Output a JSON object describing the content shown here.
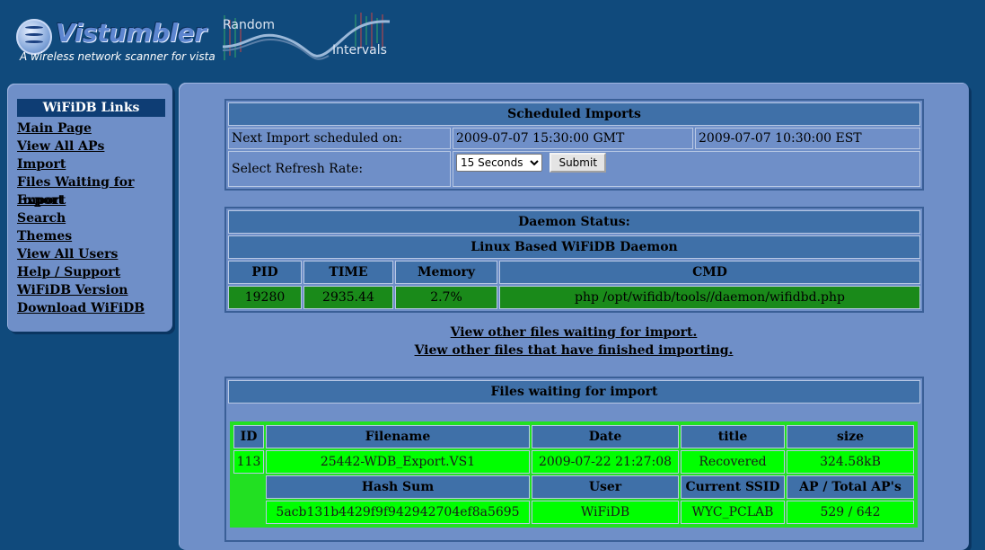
{
  "header": {
    "logo_title": "Vistumbler",
    "logo_tagline": "A wireless network scanner for vista",
    "ri_logo_line1": "Random",
    "ri_logo_line2": "Intervals"
  },
  "sidebar": {
    "heading": "WiFiDB Links",
    "items": [
      {
        "label": "Main Page"
      },
      {
        "label": "View All APs"
      },
      {
        "label": "Import"
      },
      {
        "label": "Files Waiting for Import"
      },
      {
        "label": "Export"
      },
      {
        "label": "Search"
      },
      {
        "label": "Themes"
      },
      {
        "label": "View All Users"
      },
      {
        "label": "Help / Support"
      },
      {
        "label": "WiFiDB Version"
      },
      {
        "label": "Download WiFiDB"
      }
    ]
  },
  "scheduled": {
    "title": "Scheduled Imports",
    "next_label": "Next Import scheduled on:",
    "next_gmt": "2009-07-07 15:30:00 GMT",
    "next_est": "2009-07-07 10:30:00 EST",
    "refresh_label": "Select Refresh Rate:",
    "refresh_selected": "15 Seconds",
    "submit_label": "Submit"
  },
  "daemon": {
    "title": "Daemon Status:",
    "subtitle": "Linux Based WiFiDB Daemon",
    "columns": [
      "PID",
      "TIME",
      "Memory",
      "CMD"
    ],
    "row": [
      "19280",
      "2935.44",
      "2.7%",
      "php /opt/wifidb/tools//daemon/wifidbd.php"
    ]
  },
  "links": {
    "waiting": "View other files waiting for import.",
    "finished": "View other files that have finished importing."
  },
  "files_waiting": {
    "title": "Files waiting for import",
    "head1": [
      "ID",
      "Filename",
      "Date",
      "title",
      "size"
    ],
    "row1": [
      "113",
      "25442-WDB_Export.VS1",
      "2009-07-22 21:27:08",
      "Recovered",
      "324.58kB"
    ],
    "head2": [
      "Hash Sum",
      "User",
      "Current SSID",
      "AP / Total AP's"
    ],
    "row2": [
      "5acb131b4429f9f942942704ef8a5695",
      "WiFiDB",
      "WYC_PCLAB",
      "529 / 642"
    ]
  },
  "colors": {
    "page_bg": "#104a7c",
    "panel_bg": "#6f8fc8",
    "header_cell": "#3f70a8",
    "daemon_row": "#1a8a1a",
    "file_row": "#00ff00"
  }
}
